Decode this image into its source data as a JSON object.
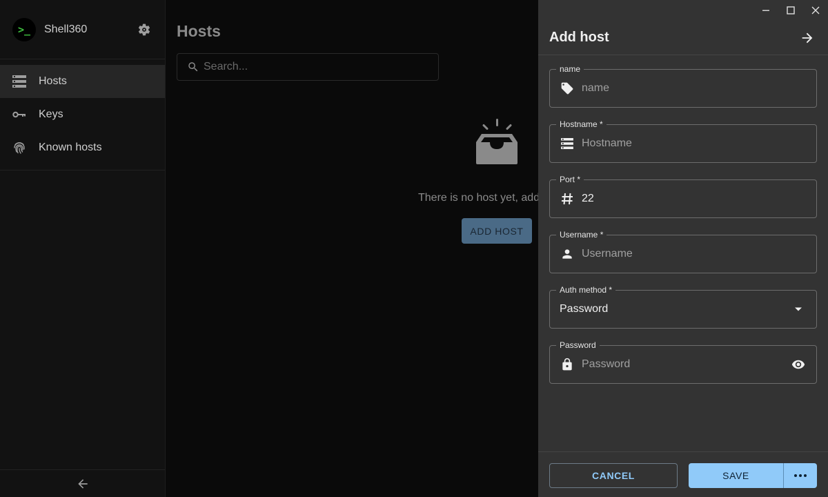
{
  "app": {
    "name": "Shell360",
    "logo_text": ">_"
  },
  "sidebar": {
    "items": [
      {
        "label": "Hosts",
        "icon": "server-icon",
        "active": true
      },
      {
        "label": "Keys",
        "icon": "key-icon",
        "active": false
      },
      {
        "label": "Known hosts",
        "icon": "fingerprint-icon",
        "active": false
      }
    ]
  },
  "main": {
    "title": "Hosts",
    "search_placeholder": "Search...",
    "empty_message": "There is no host yet, add",
    "add_host_label": "ADD HOST"
  },
  "drawer": {
    "title": "Add host",
    "fields": {
      "name": {
        "label": "name",
        "placeholder": "name",
        "value": ""
      },
      "hostname": {
        "label": "Hostname *",
        "placeholder": "Hostname",
        "value": ""
      },
      "port": {
        "label": "Port *",
        "placeholder": "",
        "value": "22"
      },
      "username": {
        "label": "Username *",
        "placeholder": "Username",
        "value": ""
      },
      "auth_method": {
        "label": "Auth method *",
        "value": "Password"
      },
      "password": {
        "label": "Password",
        "placeholder": "Password",
        "value": ""
      }
    },
    "cancel_label": "CANCEL",
    "save_label": "SAVE"
  },
  "colors": {
    "accent": "#90caf9",
    "brand_green": "#3fbf3f",
    "drawer_bg": "#333333",
    "sidebar_bg": "#121212"
  }
}
